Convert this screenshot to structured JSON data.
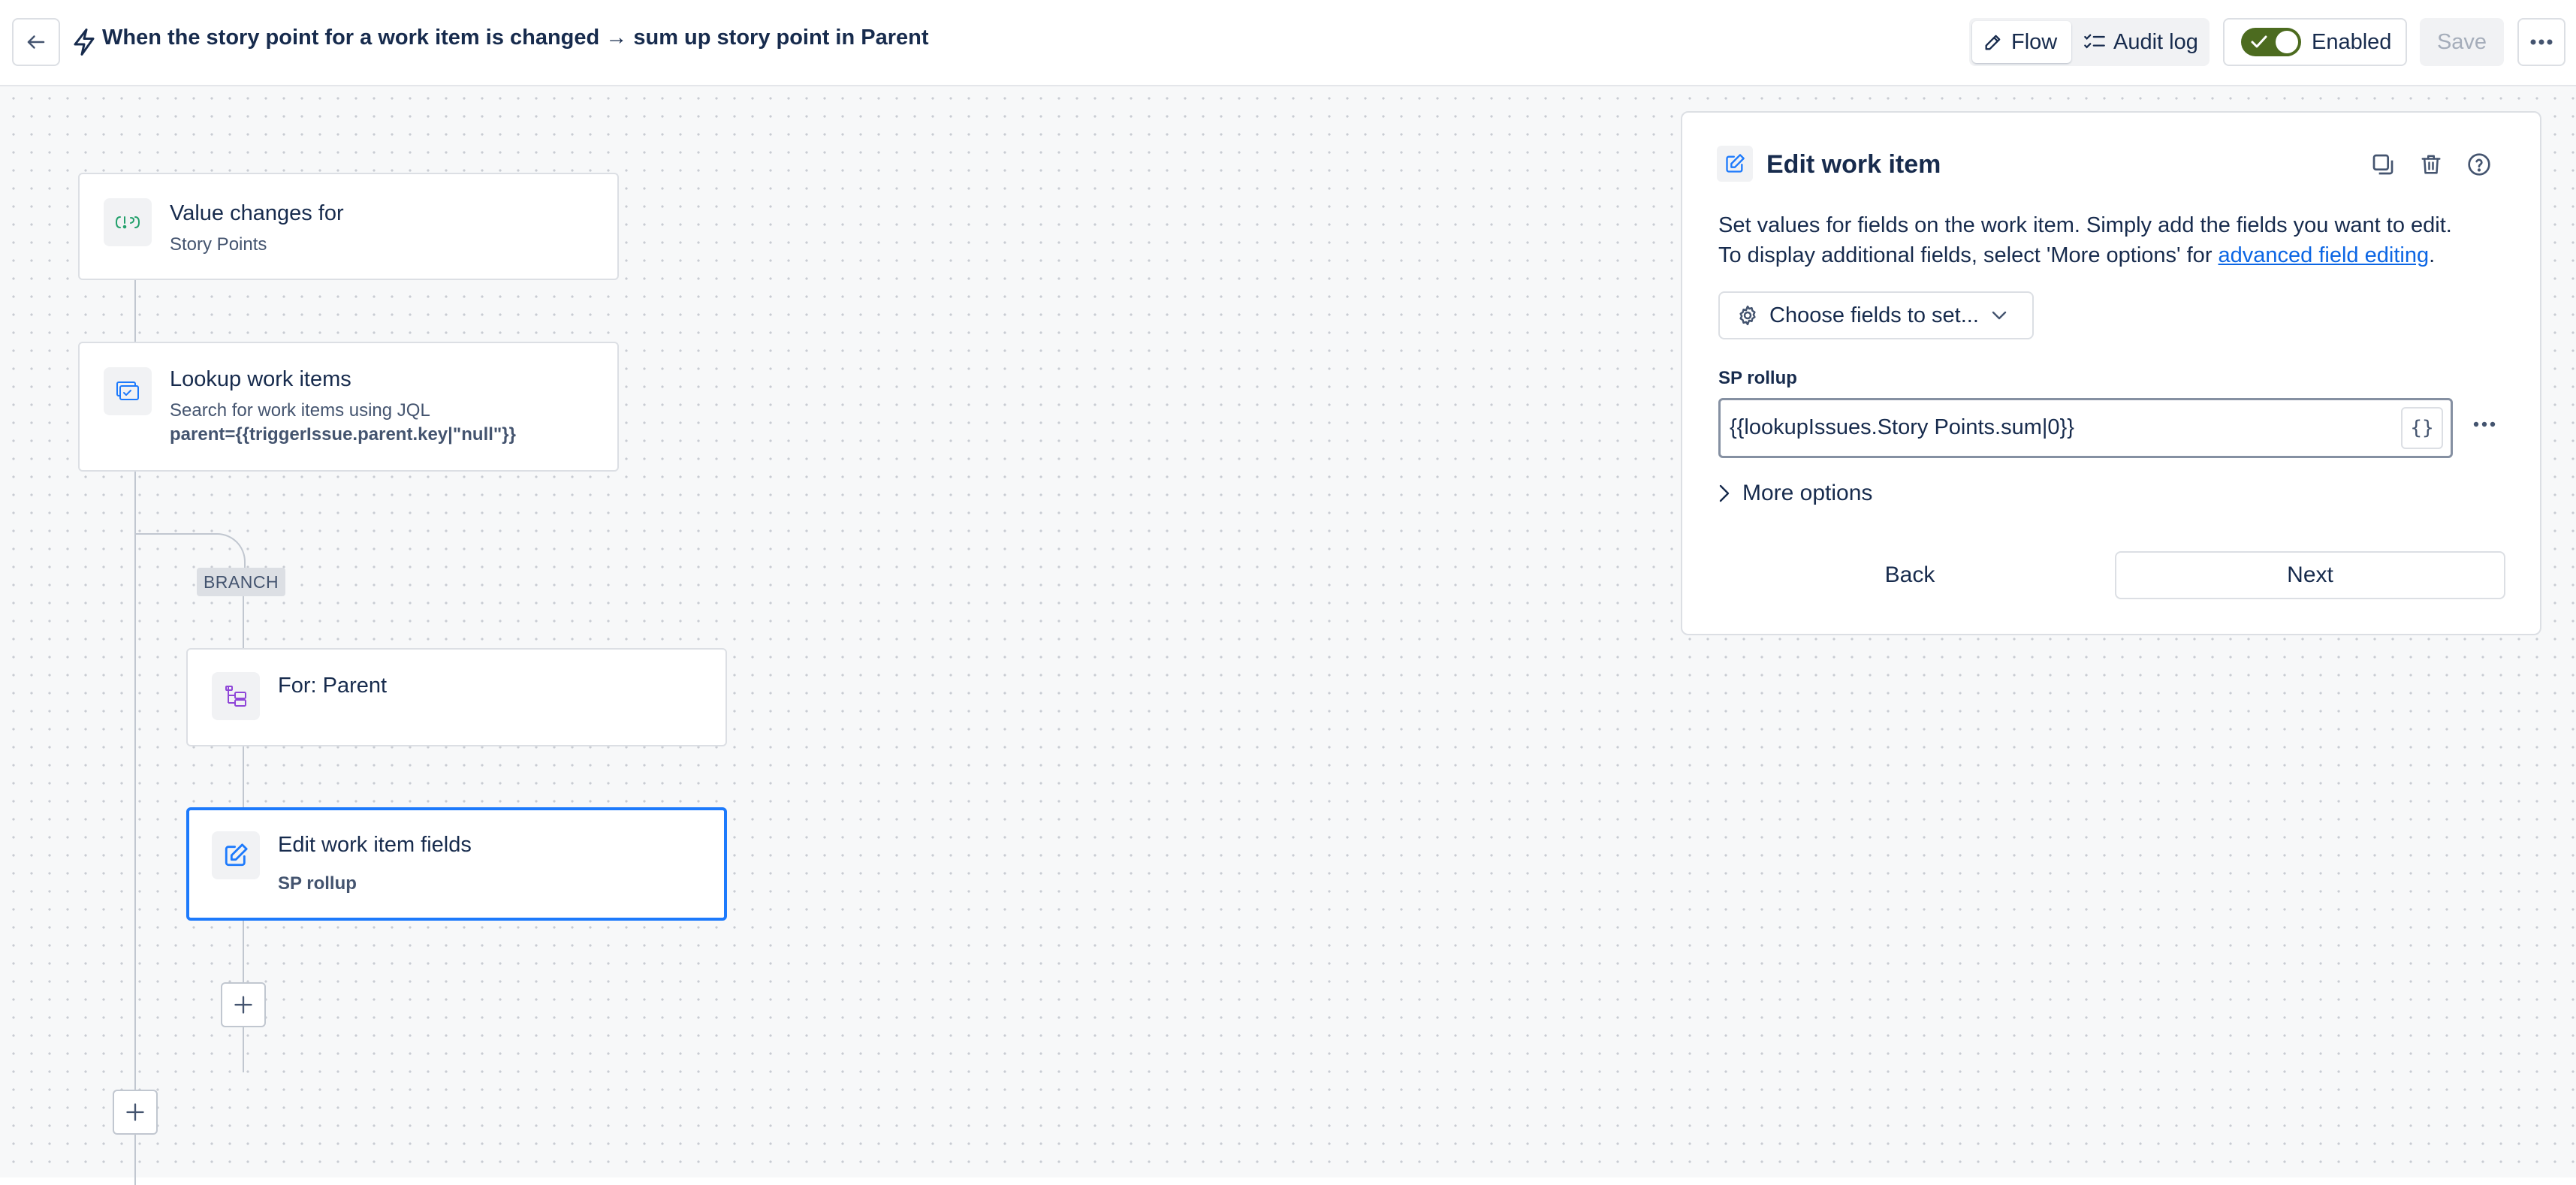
{
  "header": {
    "title": "When the story point for a work item is changed → sum up story point in Parent",
    "tabs": [
      {
        "label": "Flow",
        "icon": "pencil-icon",
        "active": true
      },
      {
        "label": "Audit log",
        "icon": "checklist-icon",
        "active": false
      }
    ],
    "enabled_label": "Enabled",
    "save_label": "Save"
  },
  "flow": {
    "trigger": {
      "title": "Value changes for",
      "subtitle": "Story Points",
      "icon": "value-change-icon"
    },
    "lookup": {
      "title": "Lookup work items",
      "subtitle": "Search for work items using JQL",
      "jql": "parent={{triggerIssue.parent.key|\"null\"}}",
      "icon": "lookup-icon"
    },
    "branch_label": "BRANCH",
    "branch_node": {
      "title": "For: Parent",
      "icon": "hierarchy-icon"
    },
    "edit_node": {
      "title": "Edit work item fields",
      "subtitle": "SP rollup",
      "icon": "edit-icon"
    }
  },
  "panel": {
    "title": "Edit work item",
    "desc_line1": "Set values for fields on the work item. Simply add the fields you want to edit.",
    "desc_line2_prefix": "To display additional fields, select 'More options' for ",
    "desc_link": "advanced field editing",
    "desc_line2_suffix": ".",
    "choose_fields_label": "Choose fields to set...",
    "field_label": "SP rollup",
    "field_value": "{{lookupIssues.Story Points.sum|0}}",
    "smart_value_glyph": "{}",
    "more_options_label": "More options",
    "back_label": "Back",
    "next_label": "Next"
  },
  "colors": {
    "accent": "#1d7afc",
    "toggle_on": "#4c6b1f",
    "link": "#0c66e4"
  }
}
